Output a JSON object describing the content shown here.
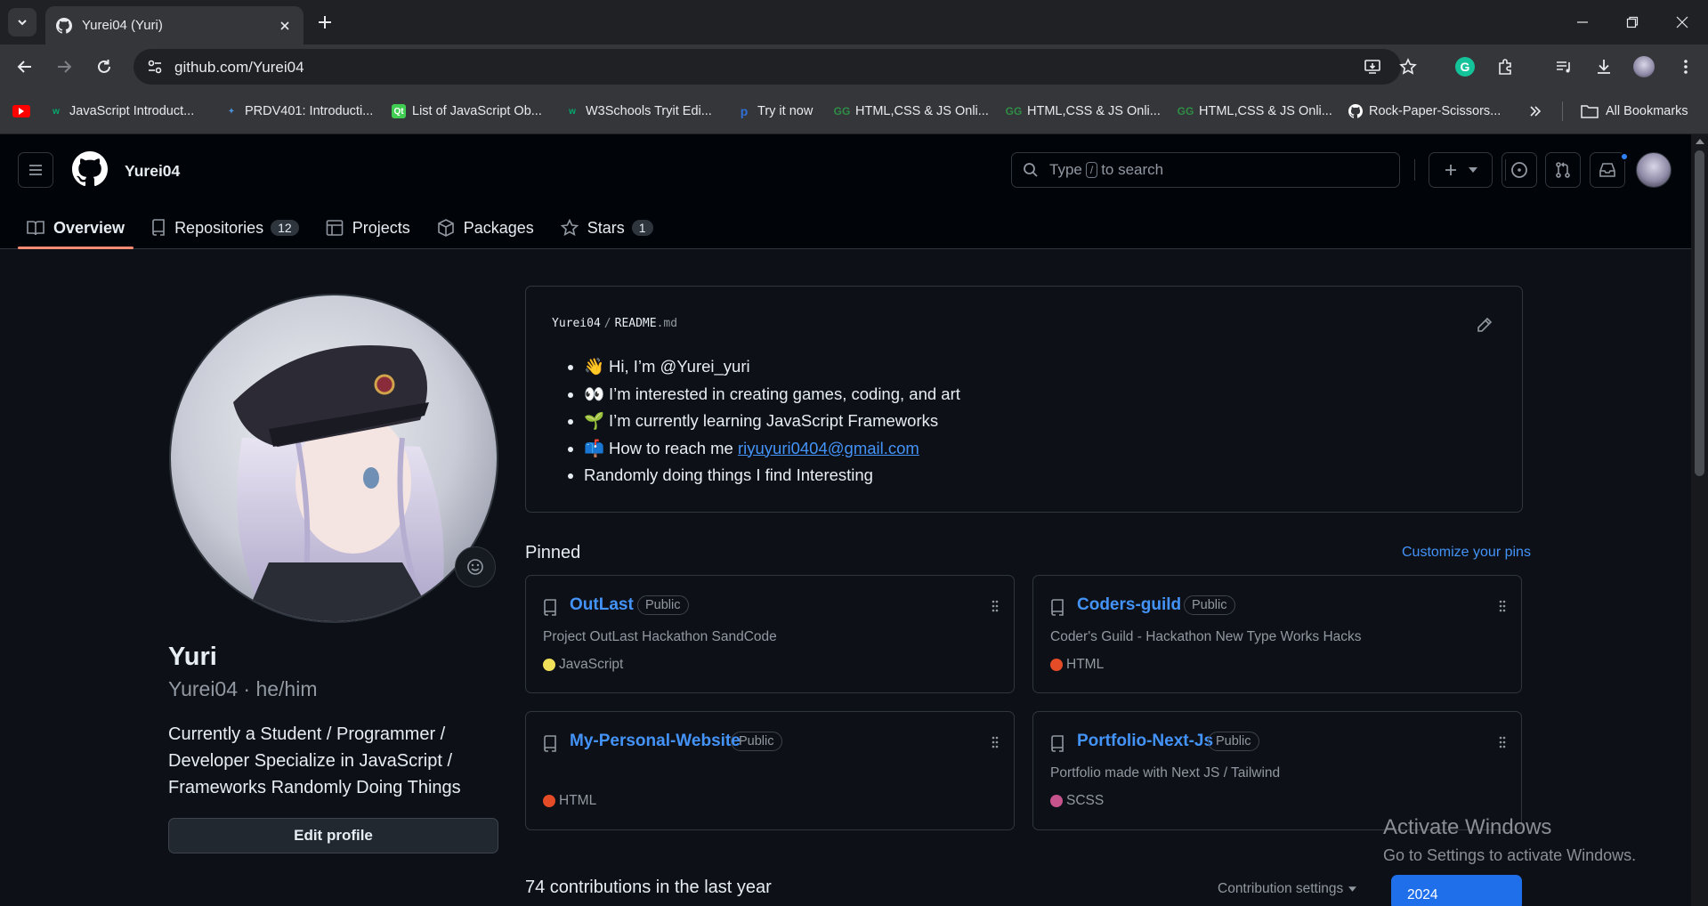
{
  "browser": {
    "tab_title": "Yurei04 (Yuri)",
    "url": "github.com/Yurei04",
    "bookmarks": [
      {
        "label": "JavaScript Introduct...",
        "icon": "w3schools-icon",
        "color": "#04aa6d"
      },
      {
        "label": "PRDV401: Introducti...",
        "icon": "saylor-icon",
        "color": "#4a90d9"
      },
      {
        "label": "List of JavaScript Ob...",
        "icon": "qt-icon",
        "color": "#41cd52"
      },
      {
        "label": "W3Schools Tryit Edi...",
        "icon": "w3schools-icon",
        "color": "#04aa6d"
      },
      {
        "label": "Try it now",
        "icon": "p-icon",
        "color": "#2f6fd6"
      },
      {
        "label": "HTML,CSS & JS Onli...",
        "icon": "geeks-icon",
        "color": "#2f8d46"
      },
      {
        "label": "HTML,CSS & JS Onli...",
        "icon": "geeks-icon",
        "color": "#2f8d46"
      },
      {
        "label": "HTML,CSS & JS Onli...",
        "icon": "geeks-icon",
        "color": "#2f8d46"
      },
      {
        "label": "Rock-Paper-Scissors...",
        "icon": "github-icon",
        "color": "#ffffff"
      }
    ],
    "all_bookmarks_label": "All Bookmarks"
  },
  "header": {
    "username": "Yurei04",
    "search_prefix": "Type",
    "search_key": "/",
    "search_suffix": "to search"
  },
  "nav_tabs": [
    {
      "label": "Overview",
      "icon": "book-icon",
      "count": null,
      "active": true
    },
    {
      "label": "Repositories",
      "icon": "repo-icon",
      "count": "12",
      "active": false
    },
    {
      "label": "Projects",
      "icon": "table-icon",
      "count": null,
      "active": false
    },
    {
      "label": "Packages",
      "icon": "package-icon",
      "count": null,
      "active": false
    },
    {
      "label": "Stars",
      "icon": "star-icon",
      "count": "1",
      "active": false
    }
  ],
  "profile": {
    "name": "Yuri",
    "handle": "Yurei04 · he/him",
    "bio": "Currently a Student / Programmer / Developer Specialize in JavaScript / Frameworks Randomly Doing Things",
    "edit_button": "Edit profile"
  },
  "readme": {
    "owner": "Yurei04",
    "sep": "/",
    "file": "README",
    "ext": ".md",
    "items": [
      {
        "emoji": "👋",
        "text": "Hi, I’m @Yurei_yuri"
      },
      {
        "emoji": "👀",
        "text": "I’m interested in creating games, coding, and art"
      },
      {
        "emoji": "🌱",
        "text": "I’m currently learning JavaScript Frameworks"
      },
      {
        "emoji": "📫",
        "text": "How to reach me ",
        "link": "riyuyuri0404@gmail.com"
      },
      {
        "emoji": "",
        "text": "Randomly doing things I find Interesting"
      }
    ]
  },
  "pinned": {
    "title": "Pinned",
    "customize": "Customize your pins",
    "repos": [
      {
        "name": "OutLast",
        "visibility": "Public",
        "description": "Project OutLast Hackathon SandCode",
        "language": "JavaScript",
        "lang_color": "#f1e05a"
      },
      {
        "name": "Coders-guild",
        "visibility": "Public",
        "description": "Coder's Guild - Hackathon New Type Works Hacks",
        "language": "HTML",
        "lang_color": "#e34c26"
      },
      {
        "name": "My-Personal-Website",
        "visibility": "Public",
        "description": "",
        "language": "HTML",
        "lang_color": "#e34c26"
      },
      {
        "name": "Portfolio-Next-Js",
        "visibility": "Public",
        "description": "Portfolio made with Next JS / Tailwind",
        "language": "SCSS",
        "lang_color": "#c6538c"
      }
    ]
  },
  "contributions": {
    "summary": "74 contributions in the last year",
    "settings": "Contribution settings",
    "year": "2024"
  },
  "watermark": {
    "line1": "Activate Windows",
    "line2": "Go to Settings to activate Windows."
  }
}
